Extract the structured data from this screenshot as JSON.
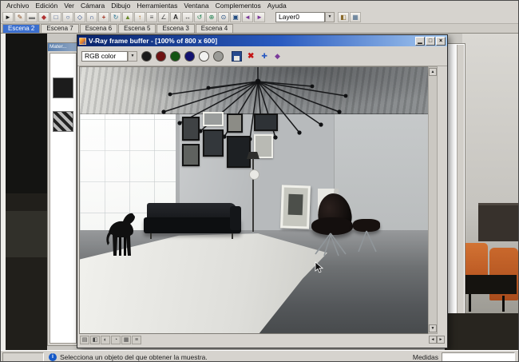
{
  "menu": {
    "items": [
      "Archivo",
      "Edición",
      "Ver",
      "Cámara",
      "Dibujo",
      "Herramientas",
      "Ventana",
      "Complementos",
      "Ayuda"
    ]
  },
  "toolbar": {
    "tools": [
      "►",
      "✎",
      "▬",
      "◆",
      "□",
      "○",
      "◇",
      "∩",
      "+",
      "↻",
      "▲",
      "↑",
      "≡",
      "∠",
      "A",
      "↔",
      "↺",
      "⊕",
      "⊙",
      "▣",
      "◄",
      "►"
    ],
    "layer_value": "Layer0",
    "dropdown_arrow": "▼",
    "extra_tools": [
      "◧",
      "▦"
    ]
  },
  "tabs": {
    "items": [
      "Escena 2",
      "Escena 7",
      "Escena 6",
      "Escena 5",
      "Escena 3",
      "Escena 4"
    ]
  },
  "materials_panel": {
    "title": "Mater..."
  },
  "vray": {
    "title": "V-Ray frame buffer - [100% of 800 x 600]",
    "buttons": {
      "minimize": "▁",
      "maximize": "□",
      "close": "×"
    },
    "channel_selected": "RGB color",
    "dropdown_arrow": "▼",
    "clear_glyph": "✖",
    "extra": [
      "✚",
      "◆"
    ],
    "bottom_icons": [
      "▤",
      "◧",
      "◐",
      "◔",
      "▦",
      "≡"
    ],
    "scroll": {
      "up": "▲",
      "down": "▼",
      "left": "◄",
      "right": "►"
    }
  },
  "status": {
    "info_glyph": "i",
    "hint": "Selecciona un objeto del que obtener la muestra.",
    "measures_label": "Medidas"
  },
  "colors": {
    "titlebar_start": "#0a246a",
    "titlebar_end": "#a6caf0",
    "tab_active": "#3b6fcf",
    "channel_red": "#6e1212",
    "channel_green": "#135413",
    "channel_blue": "#121270",
    "status_info_blue": "#1659c7",
    "chair_orange": "#c4662a"
  }
}
